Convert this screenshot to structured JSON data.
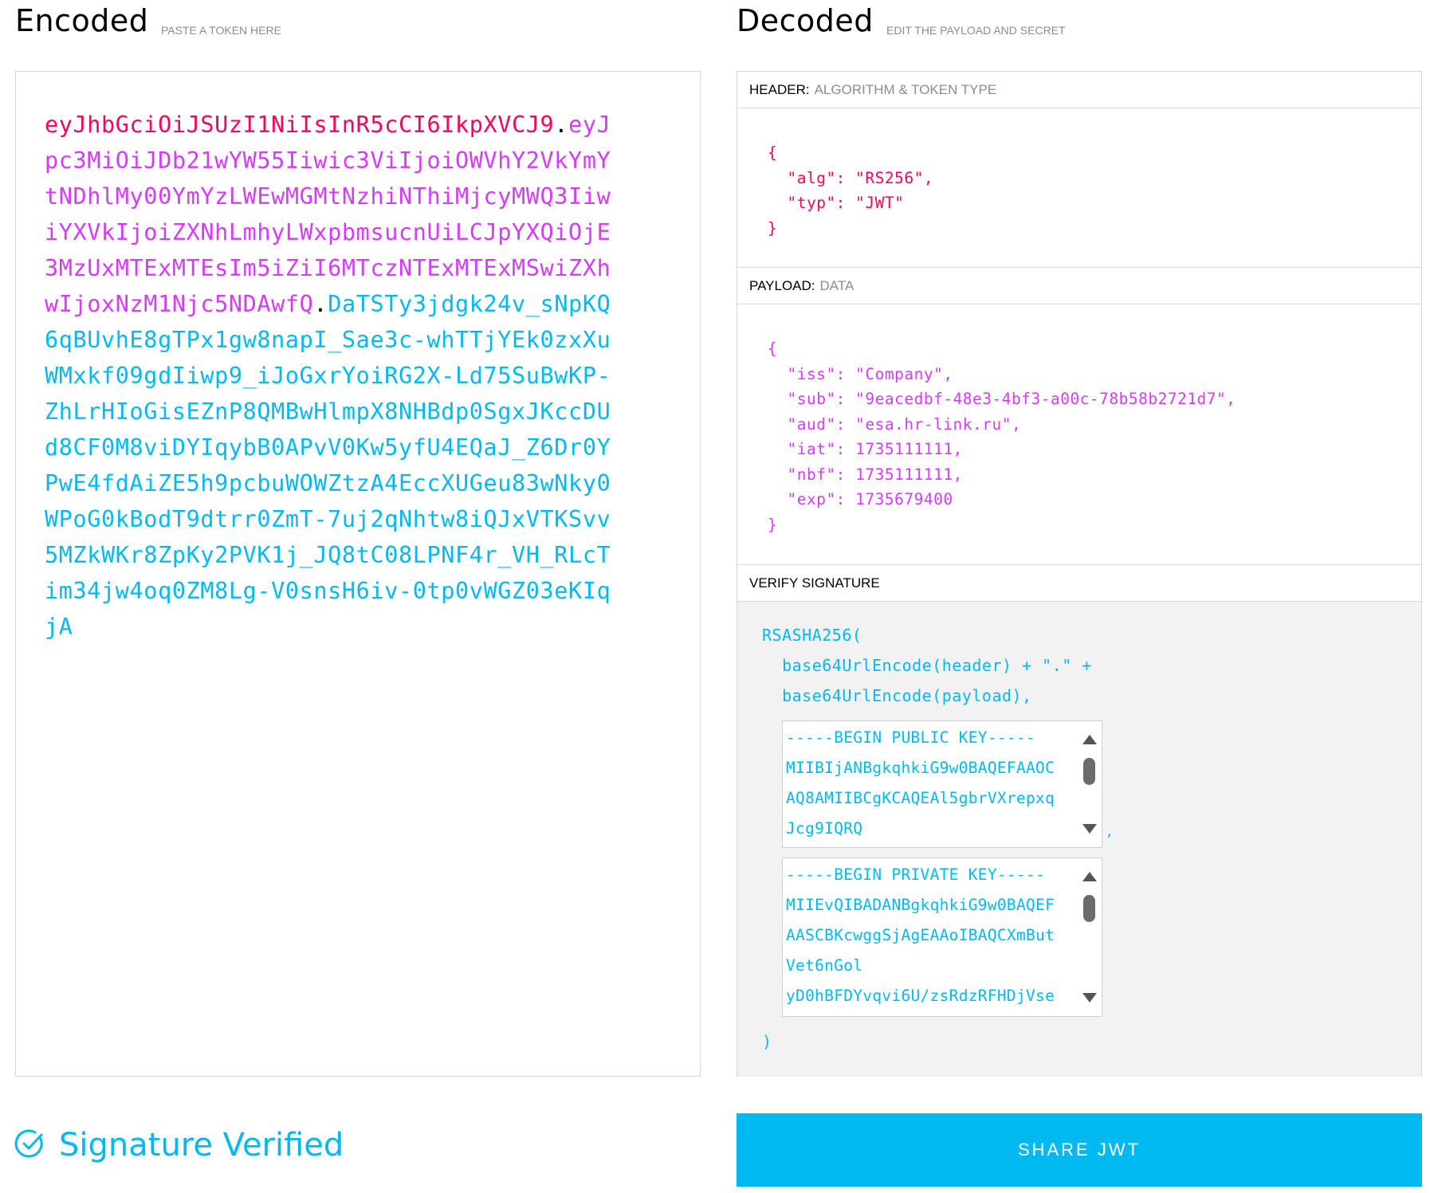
{
  "colors": {
    "header": "#fb015b",
    "payload": "#d63aff",
    "signature": "#00b9f1",
    "accent": "#00b9f1"
  },
  "encoded": {
    "title": "Encoded",
    "subtitle": "PASTE A TOKEN HERE",
    "header_part": "eyJhbGciOiJSUzI1NiIsInR5cCI6IkpXVCJ9",
    "payload_part": "eyJpc3MiOiJDb21wYW55Iiwic3ViIjoiOWVhY2VkYmYtNDhlMy00YmYzLWEwMGMtNzhiNThiMjcyMWQ3IiwiYXVkIjoiZXNhLmhyLWxpbmsucnUiLCJpYXQiOjE3MzUxMTExMTEsIm5iZiI6MTczNTExMTExMSwiZXhwIjoxNzM1Njc5NDAwfQ",
    "signature_part": "DaTSTy3jdgk24v_sNpKQ6qBUvhE8gTPx1gw8napI_Sae3c-whTTjYEk0zxXuWMxkf09gdIiwp9_iJoGxrYoiRG2X-Ld75SuBwKP-ZhLrHIoGisEZnP8QMBwHlmpX8NHBdp0SgxJKccDUd8CF0M8viDYIqybB0APvV0Kw5yfU4EQaJ_Z6Dr0YPwE4fdAiZE5h9pcbuWOWZtzA4EccXUGeu83wNky0WPoG0kBodT9dtrr0ZmT-7uj2qNhtw8iQJxVTKSvv5MZkWKr8ZpKy2PVK1j_JQ8tC08LPNF4r_VH_RLcTim34jw4oq0ZM8Lg-V0snsH6iv-0tp0vWGZ03eKIqjA",
    "dot": "."
  },
  "decoded": {
    "title": "Decoded",
    "subtitle": "EDIT THE PAYLOAD AND SECRET",
    "header": {
      "label": "HEADER:",
      "desc": "ALGORITHM & TOKEN TYPE",
      "json": "{\n  \"alg\": \"RS256\",\n  \"typ\": \"JWT\"\n}"
    },
    "payload": {
      "label": "PAYLOAD:",
      "desc": "DATA",
      "json": "{\n  \"iss\": \"Company\",\n  \"sub\": \"9eacedbf-48e3-4bf3-a00c-78b58b2721d7\",\n  \"aud\": \"esa.hr-link.ru\",\n  \"iat\": 1735111111,\n  \"nbf\": 1735111111,\n  \"exp\": 1735679400\n}"
    },
    "verify": {
      "label": "VERIFY SIGNATURE",
      "fn_open": "RSASHA256(",
      "line1": "  base64UrlEncode(header) + \".\" +",
      "line2": "  base64UrlEncode(payload),",
      "comma": ",",
      "fn_close": ")",
      "public_key_lines": [
        "-----BEGIN PUBLIC KEY-----",
        "MIIBIjANBgkqhkiG9w0BAQEFAAOC",
        "AQ8AMIIBCgKCAQEAl5gbrVXrepxq",
        "Jcg9IQRQ"
      ],
      "private_key_lines": [
        "-----BEGIN PRIVATE KEY-----",
        "MIIEvQIBADANBgkqhkiG9w0BAQEF",
        "AASCBKcwggSjAgEAAoIBAQCXmBut",
        "Vet6nGol",
        "yD0hBFDYvqvi6U/zsRdzRFHDjVse"
      ]
    }
  },
  "status": {
    "text": "Signature Verified",
    "icon": "check-circle-icon"
  },
  "share_button": {
    "label": "SHARE JWT"
  }
}
